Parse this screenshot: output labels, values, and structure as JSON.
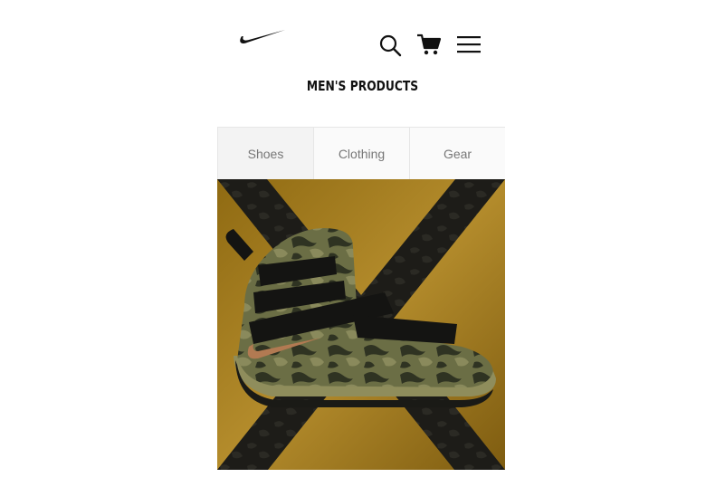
{
  "header": {
    "logo_icon": "nike-swoosh-icon",
    "search_icon": "search-icon",
    "cart_icon": "cart-icon",
    "menu_icon": "hamburger-menu-icon"
  },
  "page_title": "MEN'S PRODUCTS",
  "tabs": [
    {
      "label": "Shoes"
    },
    {
      "label": "Clothing"
    },
    {
      "label": "Gear"
    }
  ],
  "hero": {
    "image": "camouflage-high-top-basketball-shoe",
    "colors": {
      "background": "#a27c20",
      "shoe_camo": "#5a5f3a",
      "swoosh": "#b27a52"
    }
  }
}
